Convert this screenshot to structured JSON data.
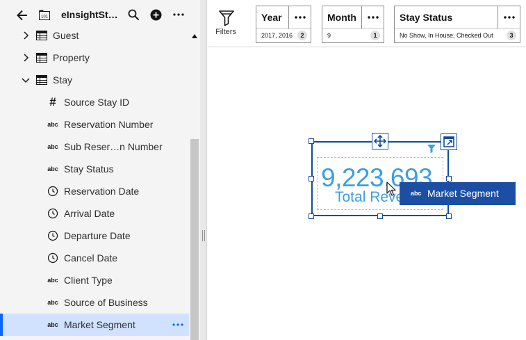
{
  "header": {
    "title": "eInsightSt…",
    "icons": [
      "back-arrow-icon",
      "data-source-icon",
      "search-icon",
      "add-icon",
      "overflow-menu-icon"
    ]
  },
  "tree": {
    "groups": [
      {
        "label": "Guest",
        "expanded": false
      },
      {
        "label": "Property",
        "expanded": false
      },
      {
        "label": "Stay",
        "expanded": true
      }
    ],
    "fields": [
      {
        "icon": "#",
        "label": "Source Stay ID"
      },
      {
        "icon": "abc",
        "label": "Reservation Number"
      },
      {
        "icon": "abc",
        "label": "Sub Reser…n Number"
      },
      {
        "icon": "abc",
        "label": "Stay Status"
      },
      {
        "icon": "clock",
        "label": "Reservation Date"
      },
      {
        "icon": "clock",
        "label": "Arrival Date"
      },
      {
        "icon": "clock",
        "label": "Departure Date"
      },
      {
        "icon": "clock",
        "label": "Cancel Date"
      },
      {
        "icon": "abc",
        "label": "Client Type"
      },
      {
        "icon": "abc",
        "label": "Source of Business"
      },
      {
        "icon": "abc",
        "label": "Market Segment",
        "selected": true
      }
    ]
  },
  "filterbar": {
    "filters_label": "Filters",
    "cards": [
      {
        "name": "Year",
        "value": "2017, 2016",
        "count": "2"
      },
      {
        "name": "Month",
        "value": "9",
        "count": "1"
      },
      {
        "name": "Stay Status",
        "value": "No Show, In House, Checked Out",
        "count": "3"
      }
    ]
  },
  "widget": {
    "value": "9,223,693",
    "label": "Total Revenue"
  },
  "drag": {
    "type_icon": "abc",
    "label": "Market Segment"
  },
  "colors": {
    "accent": "#0f62fe",
    "selection": "#d0e2ff",
    "kpi": "#3b9fe0",
    "drag_chip": "#1c4fa3",
    "widget_border": "#0f4c9c"
  }
}
